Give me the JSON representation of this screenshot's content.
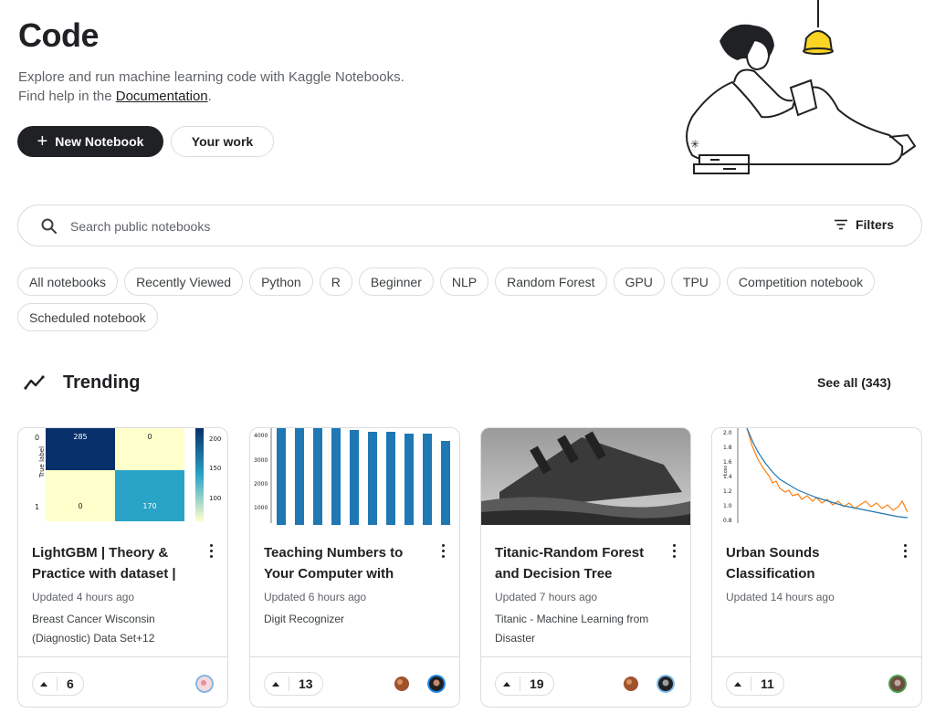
{
  "header": {
    "title": "Code",
    "intro_line1": "Explore and run machine learning code with Kaggle Notebooks.",
    "intro_line2_prefix": "Find help in the ",
    "documentation_link": "Documentation",
    "intro_line2_suffix": ".",
    "new_notebook_label": "New Notebook",
    "your_work_label": "Your work"
  },
  "search": {
    "placeholder": "Search public notebooks",
    "value": "",
    "filters_label": "Filters"
  },
  "chips": [
    "All notebooks",
    "Recently Viewed",
    "Python",
    "R",
    "Beginner",
    "NLP",
    "Random Forest",
    "GPU",
    "TPU",
    "Competition notebook",
    "Scheduled notebook"
  ],
  "trending": {
    "title": "Trending",
    "see_all": "See all (343)"
  },
  "cards": [
    {
      "title": "LightGBM | Theory & Practice with dataset |",
      "updated": "Updated 4 hours ago",
      "source": "Breast Cancer Wisconsin (Diagnostic) Data Set+12",
      "votes": "6",
      "thumb": "confusion-matrix"
    },
    {
      "title": "Teaching Numbers to Your Computer with",
      "updated": "Updated 6 hours ago",
      "source": "Digit Recognizer",
      "votes": "13",
      "thumb": "bar-chart"
    },
    {
      "title": "Titanic-Random Forest and Decision Tree",
      "updated": "Updated 7 hours ago",
      "source": "Titanic - Machine Learning from Disaster",
      "votes": "19",
      "thumb": "titanic-photo"
    },
    {
      "title": "Urban Sounds Classification",
      "updated": "Updated 14 hours ago",
      "source": "",
      "votes": "11",
      "thumb": "loss-curve"
    }
  ],
  "thumbs": {
    "confusion": {
      "ylabel": "True label",
      "row_ticks": [
        "0",
        "1"
      ],
      "cells": [
        "285",
        "0",
        "0",
        "170"
      ],
      "colorbar_ticks": [
        "200",
        "150",
        "100"
      ]
    },
    "bars": {
      "yticks": [
        "4000",
        "3000",
        "2000",
        "1000"
      ]
    },
    "loss": {
      "ylabel": "Loss",
      "yticks": [
        "2.0",
        "1.8",
        "1.6",
        "1.4",
        "1.2",
        "1.0",
        "0.8"
      ]
    }
  },
  "colors": {
    "dark": "#202124",
    "border": "#dadce0",
    "muted": "#5f6368",
    "bar": "#1f77b4",
    "heat_dark": "#08306b",
    "heat_light": "#ffffcc",
    "heat_mid": "#29a3c6"
  }
}
